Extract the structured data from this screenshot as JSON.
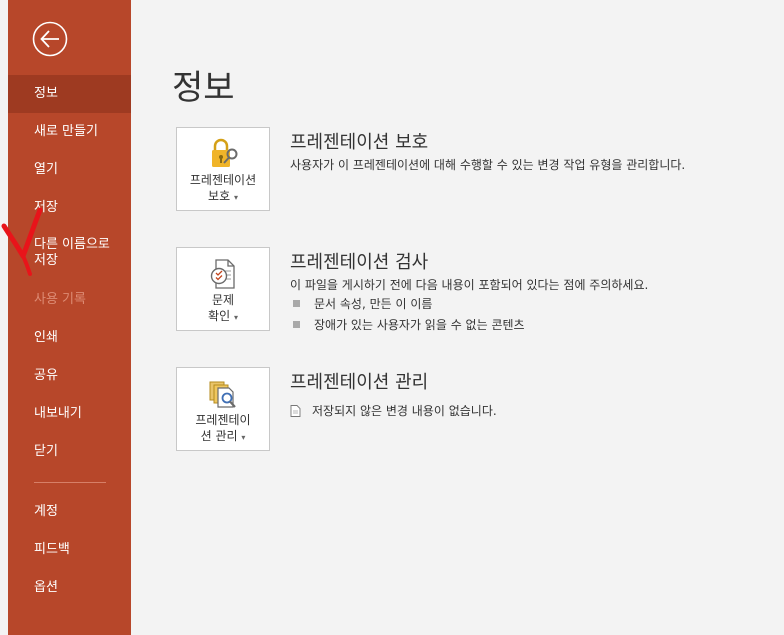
{
  "sidebar": {
    "items": [
      {
        "label": "정보"
      },
      {
        "label": "새로 만들기"
      },
      {
        "label": "열기"
      },
      {
        "label": "저장"
      },
      {
        "label_line1": "다른 이름으로",
        "label_line2": "저장"
      },
      {
        "label": "사용 기록"
      },
      {
        "label": "인쇄"
      },
      {
        "label": "공유"
      },
      {
        "label": "내보내기"
      },
      {
        "label": "닫기"
      },
      {
        "label": "계정"
      },
      {
        "label": "피드백"
      },
      {
        "label": "옵션"
      }
    ]
  },
  "main": {
    "title": "정보",
    "protect": {
      "button_line1": "프레젠테이션",
      "button_line2": "보호",
      "heading": "프레젠테이션 보호",
      "description": "사용자가 이 프레젠테이션에 대해 수행할 수 있는 변경 작업 유형을 관리합니다."
    },
    "inspect": {
      "button_line1": "문제",
      "button_line2": "확인",
      "heading": "프레젠테이션 검사",
      "description": "이 파일을 게시하기 전에 다음 내용이 포함되어 있다는 점에 주의하세요.",
      "items": [
        "문서 속성, 만든 이 이름",
        "장애가 있는 사용자가 읽을 수 없는 콘텐츠"
      ]
    },
    "manage": {
      "button_line1": "프레젠테이",
      "button_line2": "션 관리",
      "heading": "프레젠테이션 관리",
      "status": "저장되지 않은 변경 내용이 없습니다."
    }
  },
  "colors": {
    "sidebar_bg": "#b7472a",
    "sidebar_active": "#9e3a21",
    "annotation": "#e8141a"
  },
  "icons": {
    "back": "back-arrow-icon",
    "protect": "lock-icon",
    "inspect": "inspect-document-icon",
    "manage": "manage-versions-icon"
  }
}
